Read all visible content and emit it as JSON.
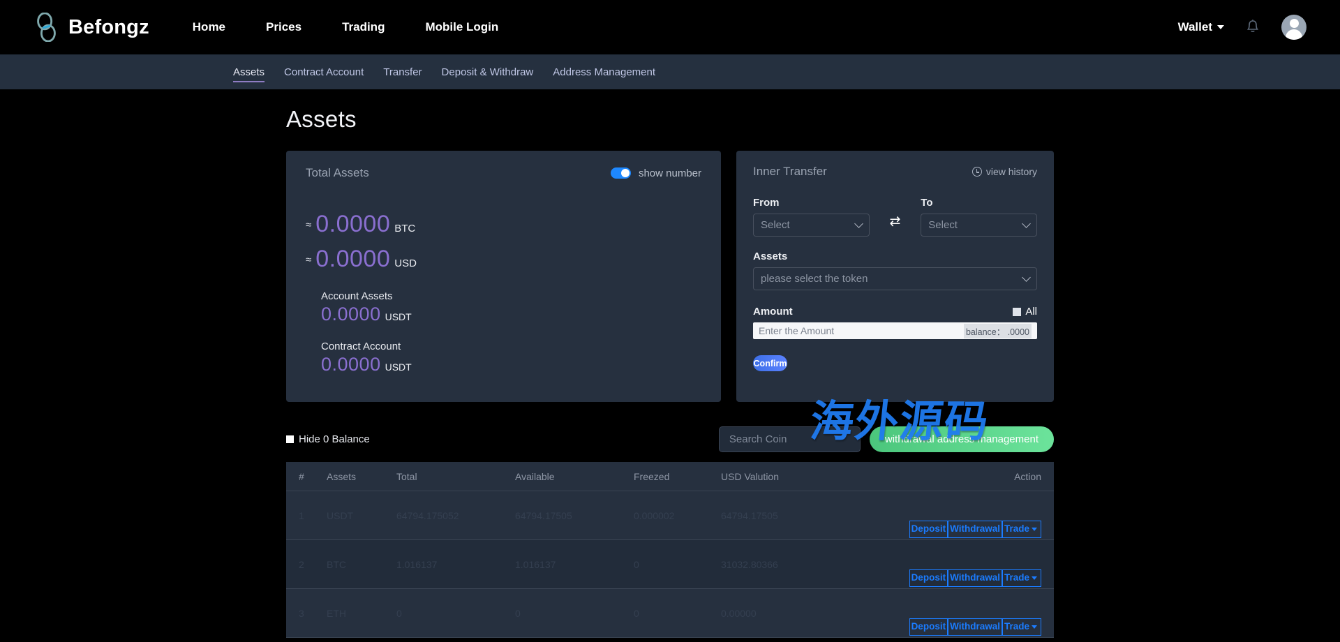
{
  "topnav": {
    "brand": "Befongz",
    "links": [
      "Home",
      "Prices",
      "Trading",
      "Mobile Login"
    ],
    "wallet": "Wallet"
  },
  "subnav": {
    "items": [
      "Assets",
      "Contract Account",
      "Transfer",
      "Deposit & Withdraw",
      "Address Management"
    ],
    "active": "Assets"
  },
  "page": {
    "title": "Assets"
  },
  "total_assets": {
    "title": "Total Assets",
    "toggle_label": "show number",
    "toggle_on": true,
    "approx": "≈",
    "btc_value": "0.0000",
    "btc_unit": "BTC",
    "usd_value": "0.0000",
    "usd_unit": "USD",
    "account_assets_label": "Account Assets",
    "account_assets_value": "0.0000",
    "account_assets_unit": "USDT",
    "contract_account_label": "Contract Account",
    "contract_account_value": "0.0000",
    "contract_account_unit": "USDT"
  },
  "inner_transfer": {
    "title": "Inner Transfer",
    "view_history": "view history",
    "from_label": "From",
    "to_label": "To",
    "from_value": "Select",
    "to_value": "Select",
    "swap_icon": "⇄",
    "assets_label": "Assets",
    "assets_placeholder": "please select the token",
    "amount_label": "Amount",
    "all_label": "All",
    "amount_placeholder": "Enter the Amount",
    "balance_text": "balance： .0000",
    "confirm_label": "Confirm"
  },
  "filters": {
    "hide_zero_label": "Hide 0 Balance",
    "search_placeholder": "Search Coin",
    "withdrawal_button": "withdrawal address management"
  },
  "table": {
    "headers": [
      "#",
      "Assets",
      "Total",
      "Available",
      "Freezed",
      "USD Valution",
      "",
      "Action"
    ],
    "action_labels": {
      "deposit": "Deposit",
      "withdrawal": "Withdrawal",
      "trade": "Trade"
    },
    "rows": [
      {
        "index": "1",
        "asset": "USDT",
        "total": "64794.175052",
        "available": "64794.17505",
        "freezed": "0.000002",
        "usd": "64794.17505"
      },
      {
        "index": "2",
        "asset": "BTC",
        "total": "1.016137",
        "available": "1.016137",
        "freezed": "0",
        "usd": "31032.80366"
      },
      {
        "index": "3",
        "asset": "ETH",
        "total": "0",
        "available": "0",
        "freezed": "0",
        "usd": "0.00000"
      }
    ]
  },
  "watermark": {
    "text": "海外源码"
  }
}
